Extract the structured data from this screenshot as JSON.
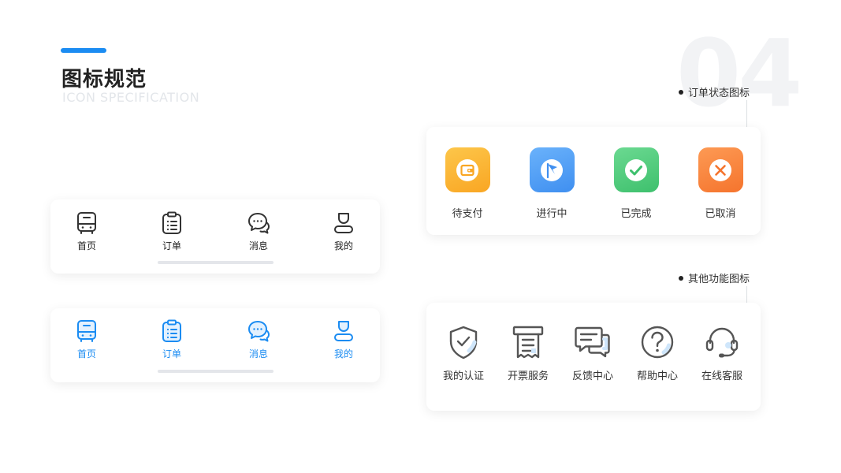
{
  "header": {
    "title": "图标规范",
    "subtitle": "ICON SPECIFICATION",
    "page_number": "04"
  },
  "colors": {
    "accent": "#1b8cf2",
    "icon_gray": "#333333",
    "pending": "#fbb232",
    "in_progress": "#4a9af5",
    "completed": "#4fcb7e",
    "cancelled": "#fa7f3d"
  },
  "tabbar_default": {
    "items": [
      {
        "label": "首页",
        "icon": "bus-icon"
      },
      {
        "label": "订单",
        "icon": "clipboard-icon"
      },
      {
        "label": "消息",
        "icon": "chat-icon"
      },
      {
        "label": "我的",
        "icon": "user-icon"
      }
    ]
  },
  "tabbar_active": {
    "items": [
      {
        "label": "首页",
        "icon": "bus-icon"
      },
      {
        "label": "订单",
        "icon": "clipboard-icon"
      },
      {
        "label": "消息",
        "icon": "chat-icon"
      },
      {
        "label": "我的",
        "icon": "user-icon"
      }
    ]
  },
  "order_status": {
    "label": "订单状态图标",
    "items": [
      {
        "label": "待支付",
        "icon": "wallet-icon"
      },
      {
        "label": "进行中",
        "icon": "flag-icon"
      },
      {
        "label": "已完成",
        "icon": "check-icon"
      },
      {
        "label": "已取消",
        "icon": "close-icon"
      }
    ]
  },
  "other_functions": {
    "label": "其他功能图标",
    "items": [
      {
        "label": "我的认证",
        "icon": "shield-check-icon"
      },
      {
        "label": "开票服务",
        "icon": "invoice-icon"
      },
      {
        "label": "反馈中心",
        "icon": "feedback-icon"
      },
      {
        "label": "帮助中心",
        "icon": "help-icon"
      },
      {
        "label": "在线客服",
        "icon": "headset-icon"
      }
    ]
  }
}
